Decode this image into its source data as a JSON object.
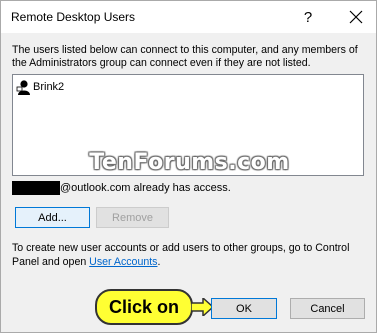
{
  "window": {
    "title": "Remote Desktop Users",
    "help_glyph": "?"
  },
  "description": "The users listed below can connect to this computer, and any members of the Administrators group can connect even if they are not listed.",
  "user_list": {
    "items": [
      "Brink2"
    ]
  },
  "watermark": "TenForums.com",
  "access": {
    "email_suffix": "@outlook.com already has access."
  },
  "buttons": {
    "add": "Add...",
    "remove": "Remove",
    "ok": "OK",
    "cancel": "Cancel"
  },
  "create_info": {
    "text_before": "To create new user accounts or add users to other groups, go to Control Panel and open ",
    "link": "User Accounts",
    "text_after": "."
  },
  "callout": {
    "text": "Click on"
  },
  "colors": {
    "callout_bg": "#ffff33",
    "accent": "#0078d7",
    "link": "#0066cc"
  },
  "icons": [
    "help-icon",
    "close-icon",
    "user-icon",
    "arrow-icon"
  ]
}
